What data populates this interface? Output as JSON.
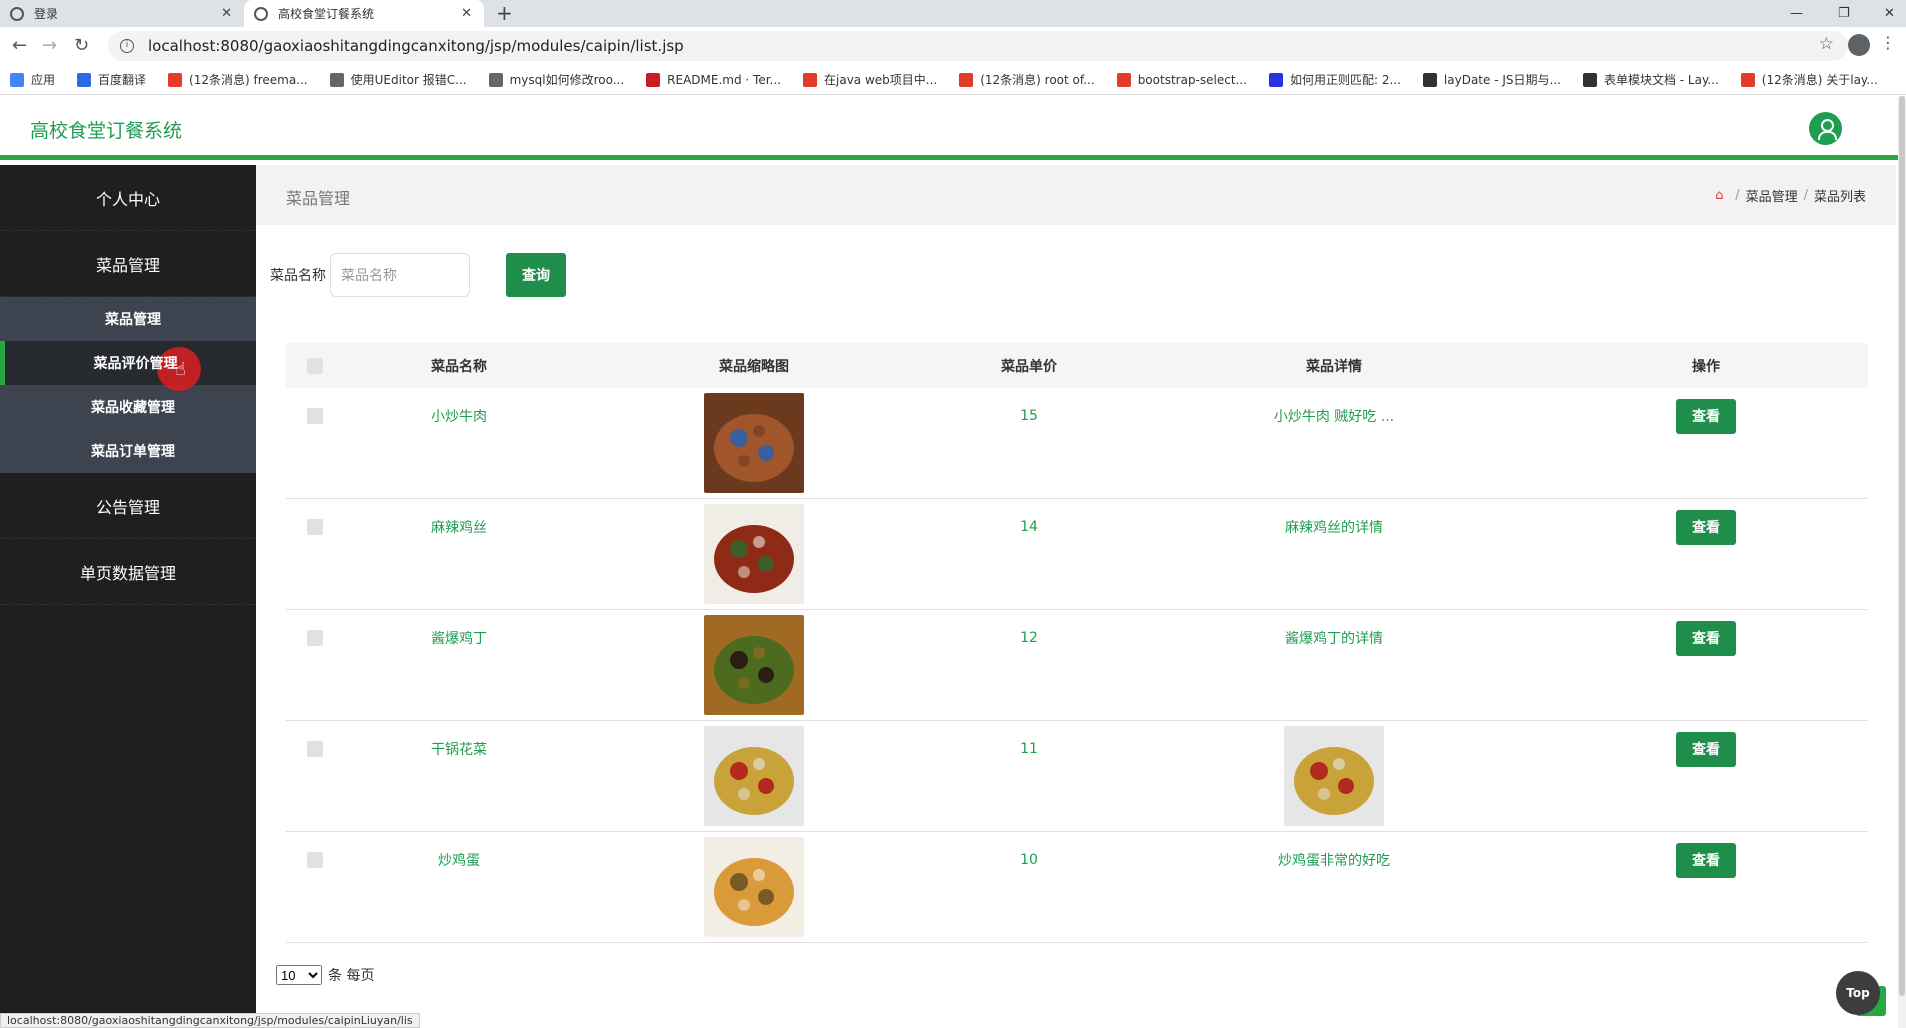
{
  "browser": {
    "tabs": [
      {
        "title": "登录"
      },
      {
        "title": "高校食堂订餐系统"
      }
    ],
    "url": "localhost:8080/gaoxiaoshitangdingcanxitong/jsp/modules/caipin/list.jsp",
    "bookmarks": [
      {
        "label": "应用",
        "color": "#4285f4"
      },
      {
        "label": "百度翻译",
        "color": "#2d6be4"
      },
      {
        "label": "(12条消息) freema...",
        "color": "#e23c2c"
      },
      {
        "label": "使用UEditor 报错C...",
        "color": "#666666"
      },
      {
        "label": "mysql如何修改roo...",
        "color": "#666666"
      },
      {
        "label": "README.md · Ter...",
        "color": "#c71d23"
      },
      {
        "label": "在java web项目中...",
        "color": "#e23c2c"
      },
      {
        "label": "(12条消息) root of...",
        "color": "#e23c2c"
      },
      {
        "label": "bootstrap-select...",
        "color": "#e23c2c"
      },
      {
        "label": "如何用正则匹配: 2...",
        "color": "#2932e1"
      },
      {
        "label": "layDate - JS日期与...",
        "color": "#333333"
      },
      {
        "label": "表单模块文档 - Lay...",
        "color": "#333333"
      },
      {
        "label": "(12条消息) 关于lay...",
        "color": "#e23c2c"
      }
    ],
    "status_url": "localhost:8080/gaoxiaoshitangdingcanxitong/jsp/modules/caipinLiuyan/lis"
  },
  "app": {
    "title": "高校食堂订餐系统",
    "accent": "#1e9e50"
  },
  "sidebar": {
    "menu": [
      {
        "label": "个人中心"
      },
      {
        "label": "菜品管理"
      }
    ],
    "submenu": [
      {
        "label": "菜品管理",
        "active": false
      },
      {
        "label": "菜品评价管理",
        "active": true
      },
      {
        "label": "菜品收藏管理",
        "active": false
      },
      {
        "label": "菜品订单管理",
        "active": false
      }
    ],
    "menu_after": [
      {
        "label": "公告管理"
      },
      {
        "label": "单页数据管理"
      }
    ]
  },
  "breadcrumb": {
    "page_title": "菜品管理",
    "items": [
      "菜品管理",
      "菜品列表"
    ]
  },
  "search": {
    "label": "菜品名称",
    "placeholder": "菜品名称",
    "button": "查询"
  },
  "table": {
    "headers": [
      "菜品名称",
      "菜品缩略图",
      "菜品单价",
      "菜品详情",
      "操作"
    ],
    "rows": [
      {
        "name": "小炒牛肉",
        "price": "15",
        "detail": "小炒牛肉 贼好吃 ...",
        "detail_is_image": false,
        "action": "查看",
        "img_colors": [
          "#6b3a1e",
          "#a0552a",
          "#3b5f9a"
        ]
      },
      {
        "name": "麻辣鸡丝",
        "price": "14",
        "detail": "麻辣鸡丝的详情",
        "detail_is_image": false,
        "action": "查看",
        "img_colors": [
          "#f0ede6",
          "#8e2a16",
          "#3f5d2a"
        ]
      },
      {
        "name": "酱爆鸡丁",
        "price": "12",
        "detail": "酱爆鸡丁的详情",
        "detail_is_image": false,
        "action": "查看",
        "img_colors": [
          "#a06a24",
          "#4d6b1e",
          "#2b1e12"
        ]
      },
      {
        "name": "干锅花菜",
        "price": "11",
        "detail": "",
        "detail_is_image": true,
        "action": "查看",
        "img_colors": [
          "#e6e6e6",
          "#c9a23a",
          "#b22a1c"
        ]
      },
      {
        "name": "炒鸡蛋",
        "price": "10",
        "detail": "炒鸡蛋非常的好吃",
        "detail_is_image": false,
        "action": "查看",
        "img_colors": [
          "#f2eee4",
          "#d99a3a",
          "#7a5a24"
        ]
      }
    ]
  },
  "pager": {
    "page_size": "10",
    "suffix": "条 每页"
  },
  "top_button": "Top"
}
